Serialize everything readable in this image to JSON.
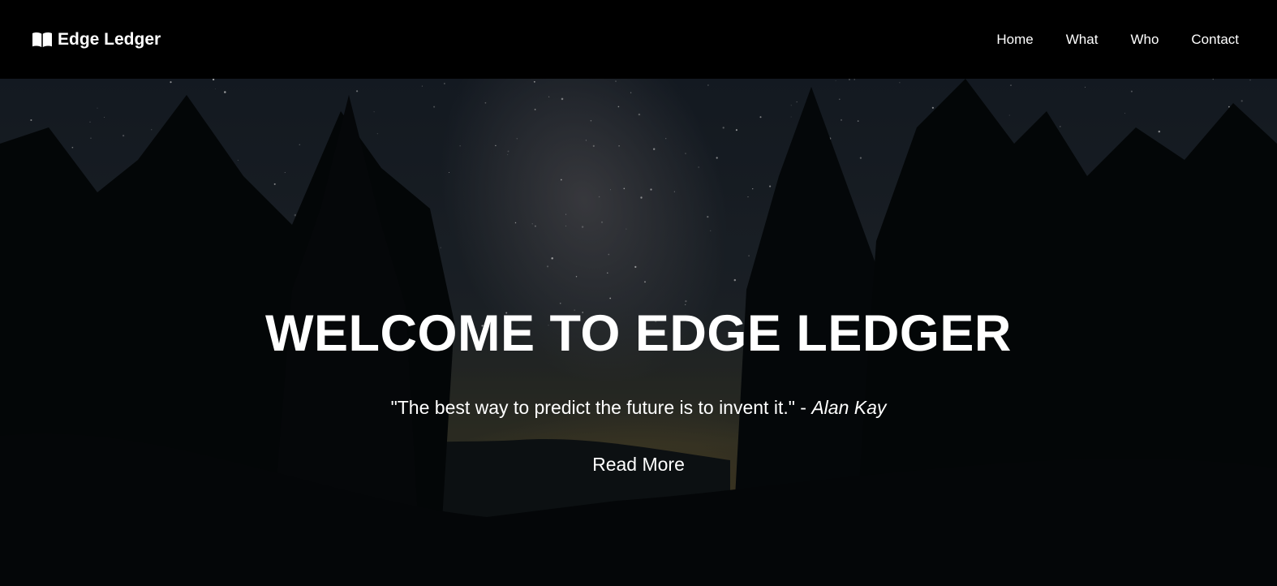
{
  "navbar": {
    "brand_icon": "open-book-icon",
    "brand_label": "Edge Ledger",
    "links": [
      {
        "label": "Home"
      },
      {
        "label": "What"
      },
      {
        "label": "Who"
      },
      {
        "label": "Contact"
      }
    ]
  },
  "hero": {
    "background": "night-sky-forest-image",
    "title": "WELCOME TO EDGE LEDGER",
    "quote_text": "\"The best way to predict the future is to invent it.\" - ",
    "quote_author": "Alan Kay",
    "cta_label": "Read More"
  },
  "colors": {
    "navbar_bg": "#000000",
    "text": "#ffffff",
    "sky": "#1b2430",
    "horizon_glow": "#6b5a33"
  }
}
